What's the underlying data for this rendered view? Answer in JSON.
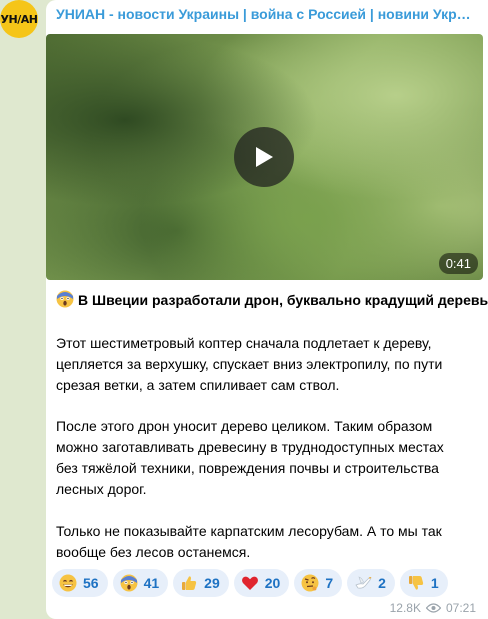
{
  "channel": {
    "avatar_text": "УН/АН",
    "name": "УНИАН - новости Украины | война с Россией | новини Україні..."
  },
  "video": {
    "duration": "0:41"
  },
  "post": {
    "title": "В Швеции разработали дрон, буквально крадущий деревья",
    "lines": [
      "Этот шестиметровый коптер сначала подлетает к дереву,",
      "цепляется за верхушку, спускает вниз электропилу, по пути",
      "срезая ветки, а затем спиливает сам ствол.",
      "После этого дрон уносит дерево целиком. Таким образом",
      "можно заготавливать древесину в труднодоступных местах",
      "без тяжёлой техники, повреждения почвы и строительства",
      "лесных дорог.",
      "Только не показывайте карпатским лесорубам. А то мы так",
      "вообще без лесов останемся."
    ]
  },
  "reactions": [
    {
      "icon": "grin-emoji-icon",
      "count": "56"
    },
    {
      "icon": "scream-emoji-icon",
      "count": "41"
    },
    {
      "icon": "thumbs-up-emoji-icon",
      "count": "29"
    },
    {
      "icon": "heart-emoji-icon",
      "count": "20"
    },
    {
      "icon": "raised-eyebrow-emoji-icon",
      "count": "7"
    },
    {
      "icon": "dove-emoji-icon",
      "count": "2"
    },
    {
      "icon": "thumbs-down-emoji-icon",
      "count": "1"
    }
  ],
  "meta": {
    "views": "12.8K",
    "time": "07:21"
  },
  "colors": {
    "accent": "#3a9bd9",
    "reaction_bg": "#e7effa",
    "reaction_text": "#1e72c3",
    "avatar": "#f5c518"
  }
}
